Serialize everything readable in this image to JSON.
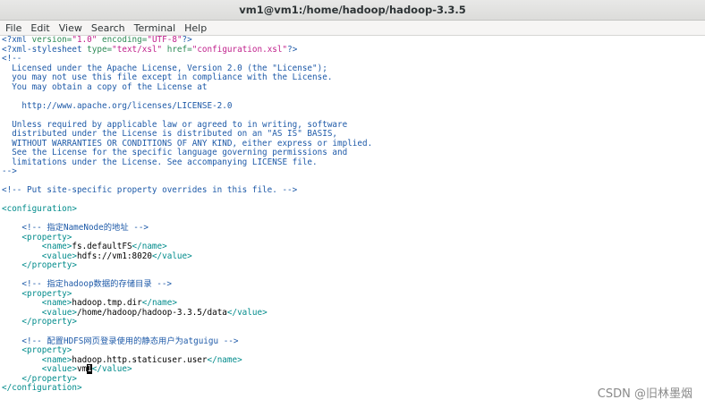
{
  "window": {
    "title": "vm1@vm1:/home/hadoop/hadoop-3.3.5"
  },
  "menubar": {
    "items": [
      "File",
      "Edit",
      "View",
      "Search",
      "Terminal",
      "Help"
    ]
  },
  "editor": {
    "lines": [
      [
        {
          "t": "<?xml ",
          "c": "pi"
        },
        {
          "t": "version=",
          "c": "attr"
        },
        {
          "t": "\"1.0\"",
          "c": "str"
        },
        {
          "t": " encoding=",
          "c": "attr"
        },
        {
          "t": "\"UTF-8\"",
          "c": "str"
        },
        {
          "t": "?>",
          "c": "pi"
        }
      ],
      [
        {
          "t": "<?xml-stylesheet ",
          "c": "pi"
        },
        {
          "t": "type=",
          "c": "attr"
        },
        {
          "t": "\"text/xsl\"",
          "c": "str"
        },
        {
          "t": " href=",
          "c": "attr"
        },
        {
          "t": "\"configuration.xsl\"",
          "c": "str"
        },
        {
          "t": "?>",
          "c": "pi"
        }
      ],
      [
        {
          "t": "<!--",
          "c": "comment"
        }
      ],
      [
        {
          "t": "  Licensed under the Apache License, Version 2.0 (the \"License\");",
          "c": "comment"
        }
      ],
      [
        {
          "t": "  you may not use this file except in compliance with the License.",
          "c": "comment"
        }
      ],
      [
        {
          "t": "  You may obtain a copy of the License at",
          "c": "comment"
        }
      ],
      [],
      [
        {
          "t": "    http://www.apache.org/licenses/LICENSE-2.0",
          "c": "comment"
        }
      ],
      [],
      [
        {
          "t": "  Unless required by applicable law or agreed to in writing, software",
          "c": "comment"
        }
      ],
      [
        {
          "t": "  distributed under the License is distributed on an \"AS IS\" BASIS,",
          "c": "comment"
        }
      ],
      [
        {
          "t": "  WITHOUT WARRANTIES OR CONDITIONS OF ANY KIND, either express or implied.",
          "c": "comment"
        }
      ],
      [
        {
          "t": "  See the License for the specific language governing permissions and",
          "c": "comment"
        }
      ],
      [
        {
          "t": "  limitations under the License. See accompanying LICENSE file.",
          "c": "comment"
        }
      ],
      [
        {
          "t": "-->",
          "c": "comment"
        }
      ],
      [],
      [
        {
          "t": "<!-- Put site-specific property overrides in this file. -->",
          "c": "comment"
        }
      ],
      [],
      [
        {
          "t": "<configuration>",
          "c": "tag"
        }
      ],
      [],
      [
        {
          "t": "    <!-- 指定NameNode的地址 -->",
          "c": "comment"
        }
      ],
      [
        {
          "t": "    ",
          "c": "text"
        },
        {
          "t": "<property>",
          "c": "tag"
        }
      ],
      [
        {
          "t": "        ",
          "c": "text"
        },
        {
          "t": "<name>",
          "c": "tag"
        },
        {
          "t": "fs.defaultFS",
          "c": "text"
        },
        {
          "t": "</name>",
          "c": "tag"
        }
      ],
      [
        {
          "t": "        ",
          "c": "text"
        },
        {
          "t": "<value>",
          "c": "tag"
        },
        {
          "t": "hdfs://vm1:8020",
          "c": "text"
        },
        {
          "t": "</value>",
          "c": "tag"
        }
      ],
      [
        {
          "t": "    ",
          "c": "text"
        },
        {
          "t": "</property>",
          "c": "tag"
        }
      ],
      [],
      [
        {
          "t": "    <!-- 指定hadoop数据的存储目录 -->",
          "c": "comment"
        }
      ],
      [
        {
          "t": "    ",
          "c": "text"
        },
        {
          "t": "<property>",
          "c": "tag"
        }
      ],
      [
        {
          "t": "        ",
          "c": "text"
        },
        {
          "t": "<name>",
          "c": "tag"
        },
        {
          "t": "hadoop.tmp.dir",
          "c": "text"
        },
        {
          "t": "</name>",
          "c": "tag"
        }
      ],
      [
        {
          "t": "        ",
          "c": "text"
        },
        {
          "t": "<value>",
          "c": "tag"
        },
        {
          "t": "/home/hadoop/hadoop-3.3.5/data",
          "c": "text"
        },
        {
          "t": "</value>",
          "c": "tag"
        }
      ],
      [
        {
          "t": "    ",
          "c": "text"
        },
        {
          "t": "</property>",
          "c": "tag"
        }
      ],
      [],
      [
        {
          "t": "    <!-- 配置HDFS网页登录使用的静态用户为atguigu -->",
          "c": "comment"
        }
      ],
      [
        {
          "t": "    ",
          "c": "text"
        },
        {
          "t": "<property>",
          "c": "tag"
        }
      ],
      [
        {
          "t": "        ",
          "c": "text"
        },
        {
          "t": "<name>",
          "c": "tag"
        },
        {
          "t": "hadoop.http.staticuser.user",
          "c": "text"
        },
        {
          "t": "</name>",
          "c": "tag"
        }
      ],
      [
        {
          "t": "        ",
          "c": "text"
        },
        {
          "t": "<value>",
          "c": "tag"
        },
        {
          "t": "vm",
          "c": "text"
        },
        {
          "t": "1",
          "c": "cursor"
        },
        {
          "t": "</value>",
          "c": "tag"
        }
      ],
      [
        {
          "t": "    ",
          "c": "text"
        },
        {
          "t": "</property>",
          "c": "tag"
        }
      ],
      [
        {
          "t": "</configuration>",
          "c": "tag"
        }
      ]
    ]
  },
  "watermark": {
    "text": "CSDN @旧林墨烟"
  }
}
